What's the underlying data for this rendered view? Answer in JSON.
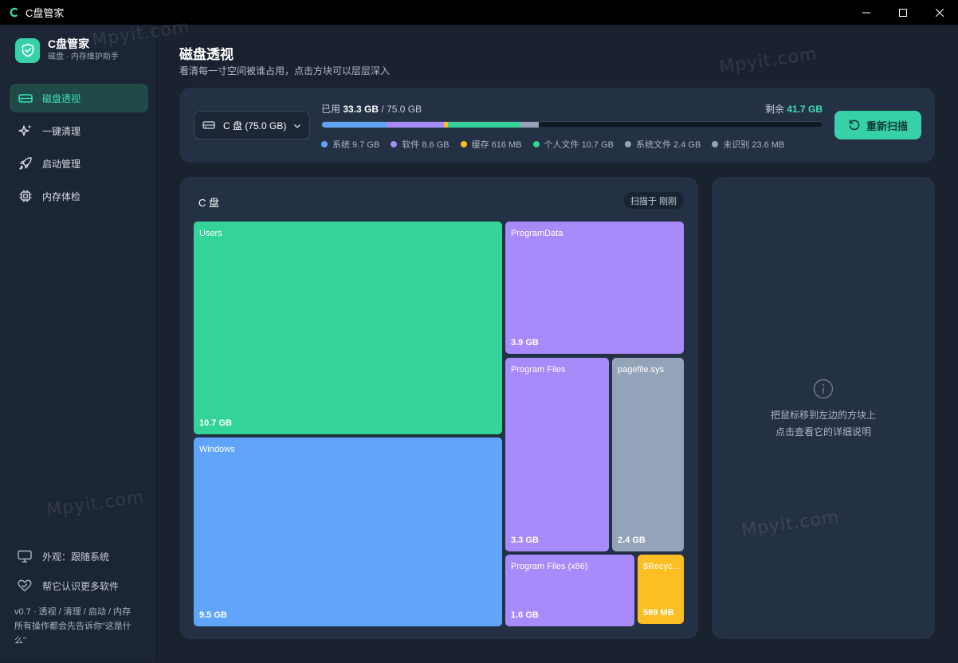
{
  "window": {
    "title": "C盘管家"
  },
  "brand": {
    "name": "C盘管家",
    "subtitle": "磁盘 · 内存维护助手"
  },
  "nav": [
    {
      "label": "磁盘透视",
      "icon": "drive-icon",
      "active": true
    },
    {
      "label": "一键清理",
      "icon": "sparkle-icon",
      "active": false
    },
    {
      "label": "启动管理",
      "icon": "rocket-icon",
      "active": false
    },
    {
      "label": "内存体检",
      "icon": "chip-icon",
      "active": false
    }
  ],
  "sidebar_bottom": {
    "appearance": "外观：跟随系统",
    "learn_more": "帮它认识更多软件",
    "version": "v0.7 · 透视 / 清理 / 启动 / 内存\n所有操作都会先告诉你\"这是什么\""
  },
  "page": {
    "title": "磁盘透视",
    "subtitle": "看清每一寸空间被谁占用，点击方块可以层层深入"
  },
  "usage": {
    "drive_label": "C 盘 (75.0 GB)",
    "used_prefix": "已用",
    "used_value": "33.3 GB",
    "total": "/ 75.0 GB",
    "remain_prefix": "剩余",
    "remain_value": "41.7 GB",
    "rescan_label": "重新扫描",
    "used_fraction": 0.427,
    "segments": [
      {
        "name": "系统",
        "size": "9.7 GB",
        "value": 9.7,
        "color": "#60a5fa"
      },
      {
        "name": "软件",
        "size": "8.6 GB",
        "value": 8.6,
        "color": "#a78bfa"
      },
      {
        "name": "缓存",
        "size": "616 MB",
        "value": 0.616,
        "color": "#fbbf24"
      },
      {
        "name": "个人文件",
        "size": "10.7 GB",
        "value": 10.7,
        "color": "#34d399"
      },
      {
        "name": "系统文件",
        "size": "2.4 GB",
        "value": 2.4,
        "color": "#94a3b8"
      },
      {
        "name": "未识别",
        "size": "23.6 MB",
        "value": 0.0236,
        "color": "#94a3b8"
      }
    ]
  },
  "treemap": {
    "title": "C 盘",
    "scan_badge": "扫描于 刚刚",
    "tiles": [
      {
        "name": "Users",
        "size": "10.7 GB",
        "color": "#34d399"
      },
      {
        "name": "ProgramData",
        "size": "3.9 GB",
        "color": "#a78bfa"
      },
      {
        "name": "Program Files",
        "size": "3.3 GB",
        "color": "#a78bfa"
      },
      {
        "name": "pagefile.sys",
        "size": "2.4 GB",
        "color": "#94a3b8"
      },
      {
        "name": "Windows",
        "size": "9.5 GB",
        "color": "#60a5fa"
      },
      {
        "name": "Program Files (x86)",
        "size": "1.6 GB",
        "color": "#a78bfa"
      },
      {
        "name": "$Recyc...",
        "size": "589 MB",
        "color": "#fbbf24"
      }
    ]
  },
  "detail": {
    "hint_line1": "把鼠标移到左边的方块上",
    "hint_line2": "点击查看它的详细说明"
  },
  "watermark": "Mpyit.com"
}
